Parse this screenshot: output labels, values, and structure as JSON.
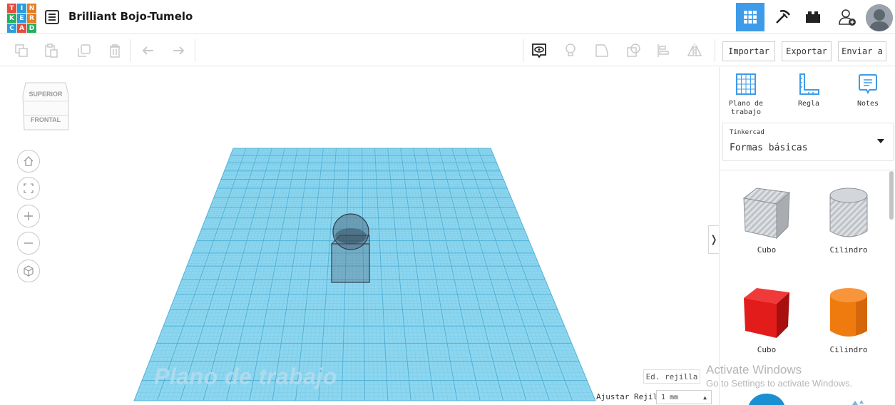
{
  "app": {
    "logo_letters": [
      "T",
      "I",
      "N",
      "K",
      "E",
      "R",
      "C",
      "A",
      "D"
    ],
    "logo_colors": [
      "#e74c3c",
      "#2d9cdb",
      "#e67e22",
      "#27ae60",
      "#2d9cdb",
      "#e67e22",
      "#2d9cdb",
      "#e74c3c",
      "#27ae60"
    ],
    "project_title": "Brilliant Bojo-Tumelo",
    "accent_color": "#3d9be9"
  },
  "header": {
    "icons": [
      "3d-design-grid-icon",
      "codeblocks-pickaxe-icon",
      "bricks-icon",
      "add-user-icon",
      "user-avatar"
    ]
  },
  "toolbar": {
    "edit_icons": [
      "copy-icon",
      "paste-icon",
      "duplicate-icon",
      "delete-icon",
      "undo-icon",
      "redo-icon"
    ],
    "view_icons": [
      "show-all-icon",
      "light-bulb-icon",
      "group-icon",
      "ungroup-icon",
      "align-icon",
      "mirror-icon"
    ],
    "import_label": "Importar",
    "export_label": "Exportar",
    "send_label": "Enviar a"
  },
  "viewport": {
    "viewcube_top": "SUPERIOR",
    "viewcube_front": "FRONTAL",
    "nav_buttons": [
      "home-view-icon",
      "fit-view-icon",
      "zoom-in-icon",
      "zoom-out-icon",
      "perspective-icon"
    ],
    "workplane_label": "Plano de trabajo",
    "edit_grid_label": "Ed. rejilla",
    "snap_grid_label": "Ajustar Rejilla",
    "snap_grid_value": "1 mm",
    "workplane_color": "#8dd6ef"
  },
  "panel": {
    "tools": [
      {
        "label_line1": "Plano de",
        "label_line2": "trabajo"
      },
      {
        "label_line1": "Regla",
        "label_line2": ""
      },
      {
        "label_line1": "Notes",
        "label_line2": ""
      }
    ],
    "library_source": "Tinkercad",
    "library_name": "Formas básicas",
    "shapes": [
      {
        "label": "Cubo",
        "kind": "hole-cube"
      },
      {
        "label": "Cilindro",
        "kind": "hole-cylinder"
      },
      {
        "label": "Cubo",
        "kind": "solid-cube",
        "color": "#e21b1b"
      },
      {
        "label": "Cilindro",
        "kind": "solid-cylinder",
        "color": "#ef7b0f"
      }
    ]
  },
  "os_watermark": {
    "line1": "Activate Windows",
    "line2": "Go to Settings to activate Windows."
  }
}
